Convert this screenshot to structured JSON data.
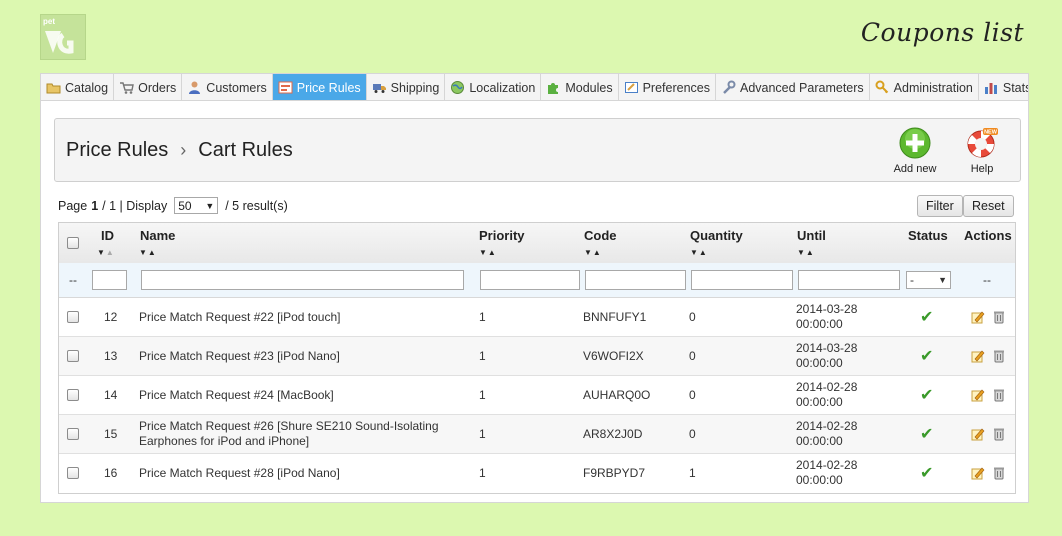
{
  "header": {
    "logo_text": "pet VG",
    "title": "Coupons list"
  },
  "tabs": [
    {
      "label": "Catalog",
      "icon": "folder-icon",
      "active": false
    },
    {
      "label": "Orders",
      "icon": "cart-icon",
      "active": false
    },
    {
      "label": "Customers",
      "icon": "user-icon",
      "active": false
    },
    {
      "label": "Price Rules",
      "icon": "price-tag-icon",
      "active": true
    },
    {
      "label": "Shipping",
      "icon": "truck-icon",
      "active": false
    },
    {
      "label": "Localization",
      "icon": "globe-icon",
      "active": false
    },
    {
      "label": "Modules",
      "icon": "puzzle-icon",
      "active": false
    },
    {
      "label": "Preferences",
      "icon": "preferences-icon",
      "active": false
    },
    {
      "label": "Advanced Parameters",
      "icon": "wrench-icon",
      "active": false
    },
    {
      "label": "Administration",
      "icon": "key-icon",
      "active": false
    },
    {
      "label": "Stats",
      "icon": "bar-chart-icon",
      "active": false
    }
  ],
  "toolbar": {
    "breadcrumb": [
      "Price Rules",
      "Cart Rules"
    ],
    "breadcrumb_sep": "›",
    "add_new_label": "Add new",
    "help_label": "Help",
    "help_badge": "NEW"
  },
  "pagination": {
    "page_label": "Page",
    "current_page": "1",
    "total_pages": "/ 1 | Display",
    "per_page": "50",
    "results": "/ 5 result(s)"
  },
  "actions": {
    "filter_label": "Filter",
    "reset_label": "Reset"
  },
  "table": {
    "columns": [
      "ID",
      "Name",
      "Priority",
      "Code",
      "Quantity",
      "Until",
      "Status",
      "Actions"
    ],
    "filter_placeholder_left": "--",
    "status_filter_value": "-",
    "actions_filter_value": "--",
    "rows": [
      {
        "id": "12",
        "name": "Price Match Request #22 [iPod touch]",
        "priority": "1",
        "code": "BNNFUFY1",
        "quantity": "0",
        "until_date": "2014-03-28",
        "until_time": "00:00:00",
        "status": "enabled"
      },
      {
        "id": "13",
        "name": "Price Match Request #23 [iPod Nano]",
        "priority": "1",
        "code": "V6WOFI2X",
        "quantity": "0",
        "until_date": "2014-03-28",
        "until_time": "00:00:00",
        "status": "enabled"
      },
      {
        "id": "14",
        "name": "Price Match Request #24 [MacBook]",
        "priority": "1",
        "code": "AUHARQ0O",
        "quantity": "0",
        "until_date": "2014-02-28",
        "until_time": "00:00:00",
        "status": "enabled"
      },
      {
        "id": "15",
        "name": "Price Match Request #26 [Shure SE210 Sound-Isolating",
        "name2": "Earphones for iPod and iPhone]",
        "priority": "1",
        "code": "AR8X2J0D",
        "quantity": "0",
        "until_date": "2014-02-28",
        "until_time": "00:00:00",
        "status": "enabled"
      },
      {
        "id": "16",
        "name": "Price Match Request #28 [iPod Nano]",
        "priority": "1",
        "code": "F9RBPYD7",
        "quantity": "1",
        "until_date": "2014-02-28",
        "until_time": "00:00:00",
        "status": "enabled"
      }
    ]
  },
  "colors": {
    "page_background": "#dcf8b0",
    "active_tab": "#4aa8e8",
    "status_green": "#3a9a2a"
  }
}
